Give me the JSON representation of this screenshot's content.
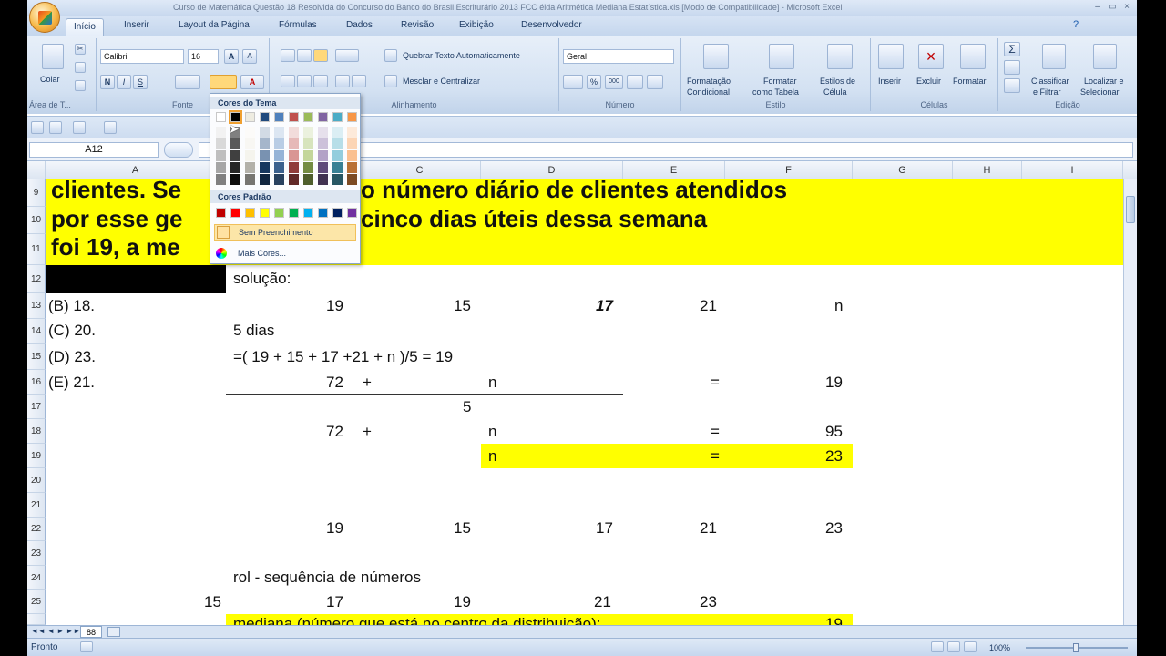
{
  "window": {
    "title": "Curso de Matemática Questão 18 Resolvida do Concurso do Banco do Brasil Escriturário 2013 FCC élda Aritmética Mediana Estatística.xls  [Modo de Compatibilidade] - Microsoft Excel",
    "minimize": "–",
    "restore": "▭",
    "close": "×"
  },
  "tabs": [
    "Início",
    "Inserir",
    "Layout da Página",
    "Fórmulas",
    "Dados",
    "Revisão",
    "Exibição",
    "Desenvolvedor"
  ],
  "ribbon": {
    "paste": "Colar",
    "font_name": "Calibri",
    "font_size": "16",
    "wrap_text": "Quebrar Texto Automaticamente",
    "merge_center": "Mesclar e Centralizar",
    "number_format": "Geral",
    "cond_format": [
      "Formatação",
      "Condicional"
    ],
    "format_table": [
      "Formatar",
      "como Tabela"
    ],
    "cell_styles": [
      "Estilos de",
      "Célula"
    ],
    "insert": "Inserir",
    "delete": "Excluir",
    "format": "Formatar",
    "sort_filter": [
      "Classificar",
      "e Filtrar"
    ],
    "find_select": [
      "Localizar e",
      "Selecionar"
    ],
    "groups": [
      "Área de T...",
      "Fonte",
      "Alinhamento",
      "Número",
      "Estilo",
      "Células",
      "Edição"
    ]
  },
  "formula_bar": {
    "name_box": "A12",
    "formula": ""
  },
  "columns": [
    "A",
    "B",
    "C",
    "D",
    "E",
    "F",
    "G",
    "H",
    "I"
  ],
  "rows": [
    "9",
    "10",
    "11",
    "12",
    "13",
    "14",
    "15",
    "16",
    "17",
    "18",
    "19",
    "20",
    "21",
    "22",
    "23",
    "24",
    "25"
  ],
  "header_text": {
    "line1": "clientes. Se",
    "line1b": "o número diário de clientes atendidos",
    "line2": "por esse ge",
    "line2b": "cinco dias úteis dessa semana",
    "line3": "foi 19, a me"
  },
  "cells": {
    "solucao": "solução:",
    "r13": {
      "a": "(B) 18.",
      "c": "19",
      "d": "15",
      "e": "17",
      "f": "21",
      "g": "n"
    },
    "r14": {
      "a": "(C) 20.",
      "b": "5 dias"
    },
    "r15": {
      "a": "(D) 23.",
      "b": "=( 19 + 15 + 17 +21 + n )/5 = 19"
    },
    "r16": {
      "a": "(E) 21.",
      "c": "72",
      "plus": "+",
      "d": "n",
      "eq": "=",
      "g": "19"
    },
    "r17": {
      "d": "5"
    },
    "r18": {
      "c": "72",
      "plus": "+",
      "d": "n",
      "eq": "=",
      "g": "95"
    },
    "r19": {
      "d": "n",
      "eq": "=",
      "g": "23"
    },
    "r22": {
      "c": "19",
      "d": "15",
      "e": "17",
      "f": "21",
      "g": "23"
    },
    "r24": {
      "b": "rol - sequência de números"
    },
    "r25": {
      "a": "15",
      "c": "17",
      "d": "19",
      "e": "21",
      "f": "23"
    },
    "r26": {
      "b": "mediana (número que está no centro da distribuição):",
      "g": "19"
    }
  },
  "color_popup": {
    "theme_label": "Cores do Tema",
    "standard_label": "Cores Padrão",
    "no_fill": "Sem Preenchimento",
    "more_colors": "Mais Cores...",
    "theme_colors": [
      "#ffffff",
      "#000000",
      "#eeece1",
      "#1f497d",
      "#4f81bd",
      "#c0504d",
      "#9bbb59",
      "#8064a2",
      "#4bacc6",
      "#f79646"
    ],
    "standard_colors": [
      "#c00000",
      "#ff0000",
      "#ffc000",
      "#ffff00",
      "#92d050",
      "#00b050",
      "#00b0f0",
      "#0070c0",
      "#002060",
      "#7030a0"
    ]
  },
  "status": {
    "ready": "Pronto",
    "zoom": "100%"
  },
  "sheet_tab": "88"
}
